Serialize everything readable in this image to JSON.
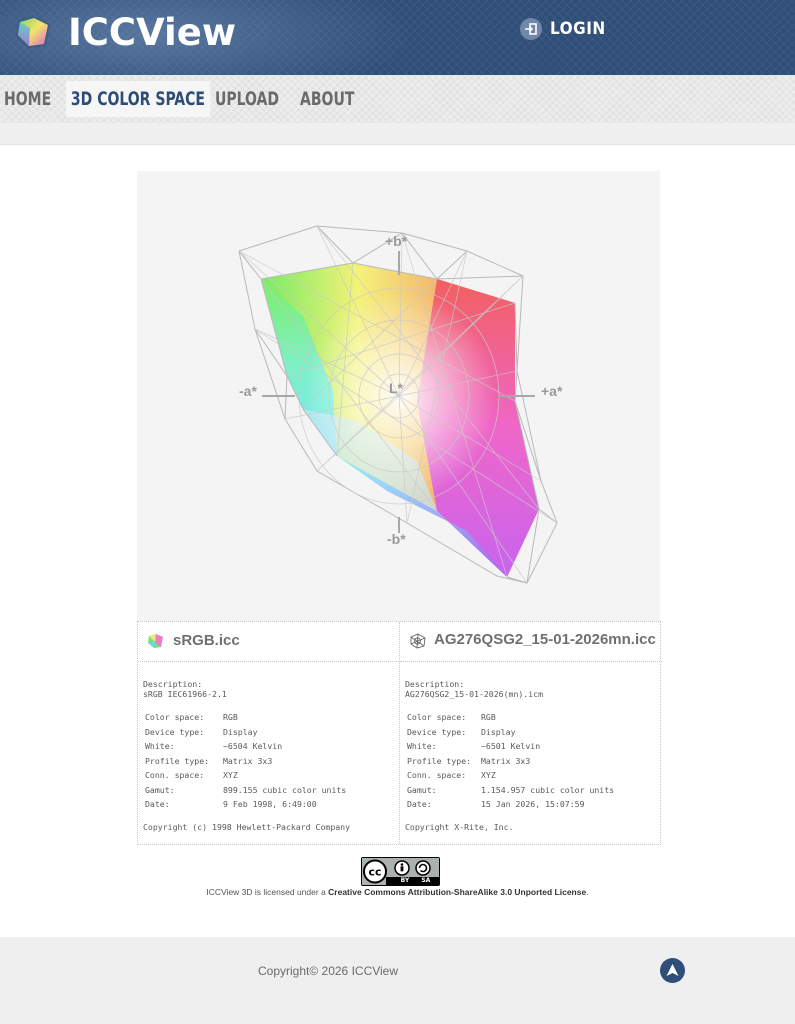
{
  "header": {
    "app_name": "ICCView",
    "login_label": "LOGIN",
    "logo_icon": "gamut-cube-icon",
    "login_icon": "sign-in-icon"
  },
  "nav": {
    "items": [
      {
        "label": "HOME",
        "active": false
      },
      {
        "label": "3D COLOR SPACE",
        "active": true
      },
      {
        "label": "UPLOAD",
        "active": false
      },
      {
        "label": "ABOUT",
        "active": false
      }
    ]
  },
  "viewer": {
    "axis_labels": {
      "plus_b": "+b*",
      "minus_b": "-b*",
      "minus_a": "-a*",
      "plus_a": "+a*",
      "l": "L*"
    }
  },
  "profiles": {
    "left": {
      "icon": "srgb-gamut-icon",
      "file_name": "sRGB.icc",
      "description_label": "Description:",
      "description": "sRGB IEC61966-2.1",
      "props": [
        {
          "key": "Color space:",
          "value": "RGB"
        },
        {
          "key": "Device type:",
          "value": "Display"
        },
        {
          "key": "White:",
          "value": "~6504 Kelvin"
        },
        {
          "key": "Profile type:",
          "value": "Matrix 3x3"
        },
        {
          "key": "Conn. space:",
          "value": "XYZ"
        },
        {
          "key": "Gamut:",
          "value": "899.155 cubic color units"
        },
        {
          "key": "Date:",
          "value": "9 Feb 1998, 6:49:00"
        }
      ],
      "copyright": "Copyright (c) 1998 Hewlett-Packard Company"
    },
    "right": {
      "icon": "wireframe-gamut-icon",
      "file_name": "AG276QSG2_15-01-2026mn.icc",
      "description_label": "Description:",
      "description": "AG276QSG2_15-01-2026(mn).icm",
      "props": [
        {
          "key": "Color space:",
          "value": "RGB"
        },
        {
          "key": "Device type:",
          "value": "Display"
        },
        {
          "key": "White:",
          "value": "~6501 Kelvin"
        },
        {
          "key": "Profile type:",
          "value": "Matrix 3x3"
        },
        {
          "key": "Conn. space:",
          "value": "XYZ"
        },
        {
          "key": "Gamut:",
          "value": "1.154.957 cubic color units"
        },
        {
          "key": "Date:",
          "value": "15 Jan 2026, 15:07:59"
        }
      ],
      "copyright": "Copyright X-Rite, Inc."
    }
  },
  "license": {
    "badge_text": "BY SA",
    "prefix": "ICCView 3D is licensed under a ",
    "link": "Creative Commons Attribution-ShareAlike 3.0 Unported License",
    "suffix": "."
  },
  "footer": {
    "copyright": "Copyright© 2026 ICCView",
    "back_to_top_icon": "arrow-up-icon"
  }
}
